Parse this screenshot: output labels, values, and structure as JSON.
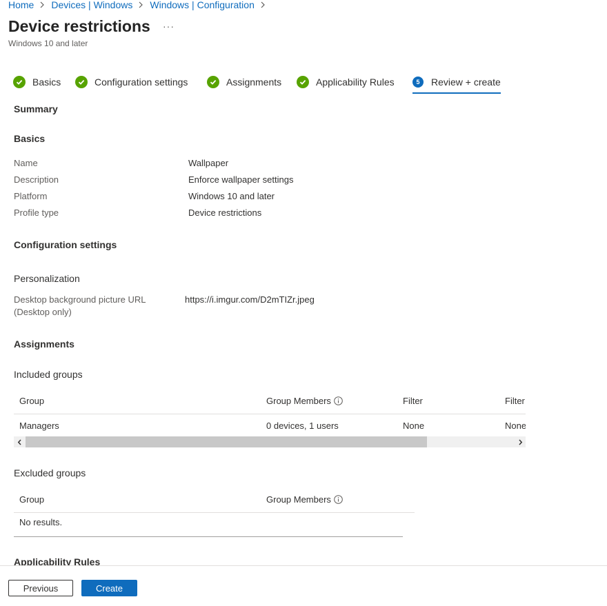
{
  "breadcrumb": [
    "Home",
    "Devices | Windows",
    "Windows | Configuration"
  ],
  "header": {
    "title": "Device restrictions",
    "more": "···",
    "subtitle": "Windows 10 and later"
  },
  "steps": [
    {
      "label": "Basics",
      "status": "complete"
    },
    {
      "label": "Configuration settings",
      "status": "complete"
    },
    {
      "label": "Assignments",
      "status": "complete"
    },
    {
      "label": "Applicability Rules",
      "status": "complete"
    },
    {
      "label": "Review + create",
      "status": "current",
      "number": "5"
    }
  ],
  "summary": {
    "heading": "Summary",
    "basics": {
      "heading": "Basics",
      "fields": [
        {
          "label": "Name",
          "value": "Wallpaper"
        },
        {
          "label": "Description",
          "value": "Enforce wallpaper settings"
        },
        {
          "label": "Platform",
          "value": "Windows 10 and later"
        },
        {
          "label": "Profile type",
          "value": "Device restrictions"
        }
      ]
    },
    "configuration": {
      "heading": "Configuration settings",
      "category": "Personalization",
      "setting_label_line1": "Desktop background picture URL",
      "setting_label_line2": "(Desktop only)",
      "setting_value": "https://i.imgur.com/D2mTIZr.jpeg"
    },
    "assignments": {
      "heading": "Assignments",
      "included": {
        "heading": "Included groups",
        "columns": [
          "Group",
          "Group Members",
          "Filter",
          "Filter"
        ],
        "rows": [
          [
            "Managers",
            "0 devices, 1 users",
            "None",
            "None"
          ]
        ]
      },
      "excluded": {
        "heading": "Excluded groups",
        "columns": [
          "Group",
          "Group Members"
        ],
        "empty_text": "No results."
      }
    },
    "applicability": {
      "heading": "Applicability Rules"
    }
  },
  "footer": {
    "previous_label": "Previous",
    "create_label": "Create"
  },
  "colors": {
    "accent": "#0f6cbd",
    "success": "#57a300"
  }
}
